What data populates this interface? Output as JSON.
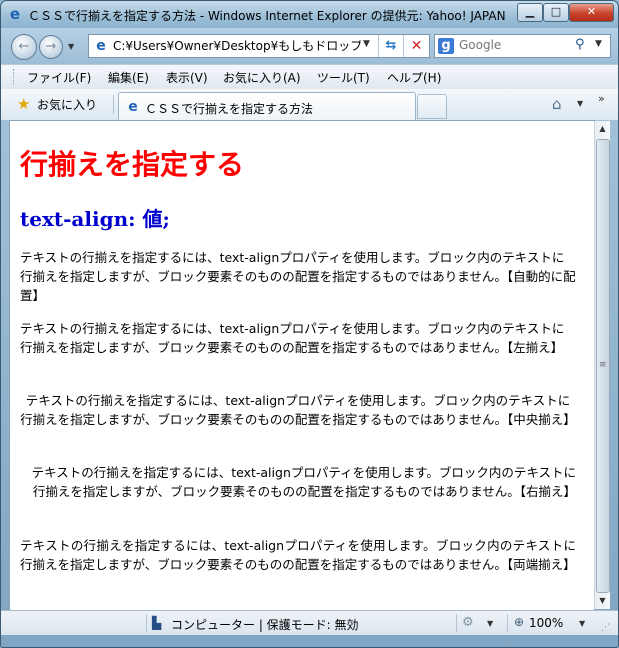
{
  "window": {
    "title": "ＣＳＳで行揃えを指定する方法 - Windows Internet Explorer の提供元: Yahoo! JAPAN",
    "minimize_icon": "minimize-icon",
    "maximize_icon": "maximize-icon",
    "close_icon": "close-icon"
  },
  "nav": {
    "address_value": "C:¥Users¥Owner¥Desktop¥もしもドロップ",
    "search_placeholder": "Google"
  },
  "menu": {
    "items": [
      "ファイル(F)",
      "編集(E)",
      "表示(V)",
      "お気に入り(A)",
      "ツール(T)",
      "ヘルプ(H)"
    ]
  },
  "favorites": {
    "label": "お気に入り",
    "tab_label": "ＣＳＳで行揃えを指定する方法"
  },
  "page": {
    "heading": "行揃えを指定する",
    "subheading": "text-align: 値;",
    "paragraphs": [
      "テキストの行揃えを指定するには、text-alignプロパティを使用します。ブロック内のテキストに行揃えを指定しますが、ブロック要素そのものの配置を指定するものではありません。【自動的に配置】",
      "テキストの行揃えを指定するには、text-alignプロパティを使用します。ブロック内のテキストに行揃えを指定しますが、ブロック要素そのものの配置を指定するものではありません。【左揃え】",
      "テキストの行揃えを指定するには、text-alignプロパティを使用します。ブロック内のテキストに行揃えを指定しますが、ブロック要素そのものの配置を指定するものではありません。【中央揃え】",
      "テキストの行揃えを指定するには、text-alignプロパティを使用します。ブロック内のテキストに行揃えを指定しますが、ブロック要素そのものの配置を指定するものではありません。【右揃え】",
      "テキストの行揃えを指定するには、text-alignプロパティを使用します。ブロック内のテキストに行揃えを指定しますが、ブロック要素そのものの配置を指定するものではありません。【両端揃え】"
    ],
    "heading_color": "#ff0000",
    "subheading_color": "#0000cc"
  },
  "status": {
    "zone_text": "コンピューター | 保護モード: 無効",
    "zoom": "100%"
  }
}
